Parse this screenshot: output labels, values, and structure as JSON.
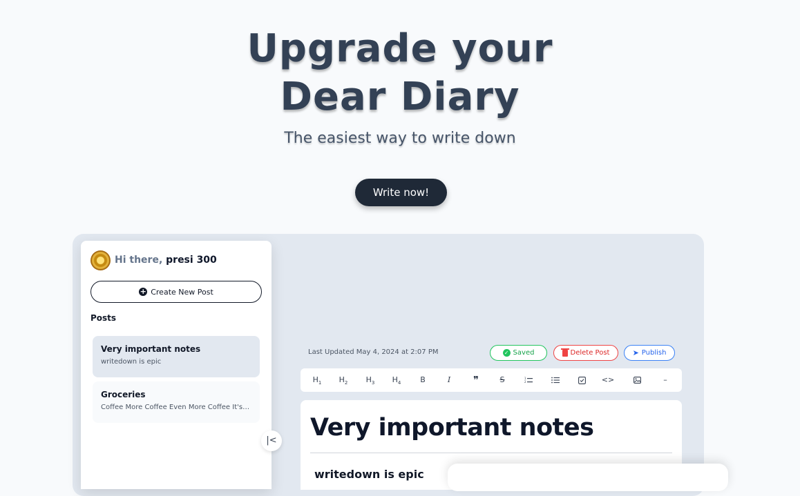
{
  "hero": {
    "title_line1": "Upgrade your",
    "title_line2": "Dear Diary",
    "subtitle": "The easiest way to write down",
    "cta_label": "Write now!"
  },
  "sidebar": {
    "greeting": "Hi there,",
    "username": "presi 300",
    "create_label": "Create New Post",
    "posts_heading": "Posts",
    "posts": [
      {
        "title": "Very important notes",
        "excerpt": "writedown is epic"
      },
      {
        "title": "Groceries",
        "excerpt": "Coffee More Coffee Even More Coffee It's a..."
      }
    ],
    "collapse_icon": "|<"
  },
  "editor": {
    "last_updated": "Last Updated May 4, 2024 at 2:07 PM",
    "saved_label": "Saved",
    "delete_label": "Delete Post",
    "publish_label": "Publish",
    "toolbar": [
      "H1",
      "H2",
      "H3",
      "H4",
      "B",
      "I",
      "99",
      "S",
      "ol",
      "ul",
      "task",
      "<>",
      "img",
      "—"
    ],
    "doc_title": "Very important notes",
    "doc_body": "writedown is epic"
  },
  "colors": {
    "dark": "#1f2937",
    "saved": "#16a34a",
    "delete": "#dc2626",
    "publish": "#2563eb"
  }
}
